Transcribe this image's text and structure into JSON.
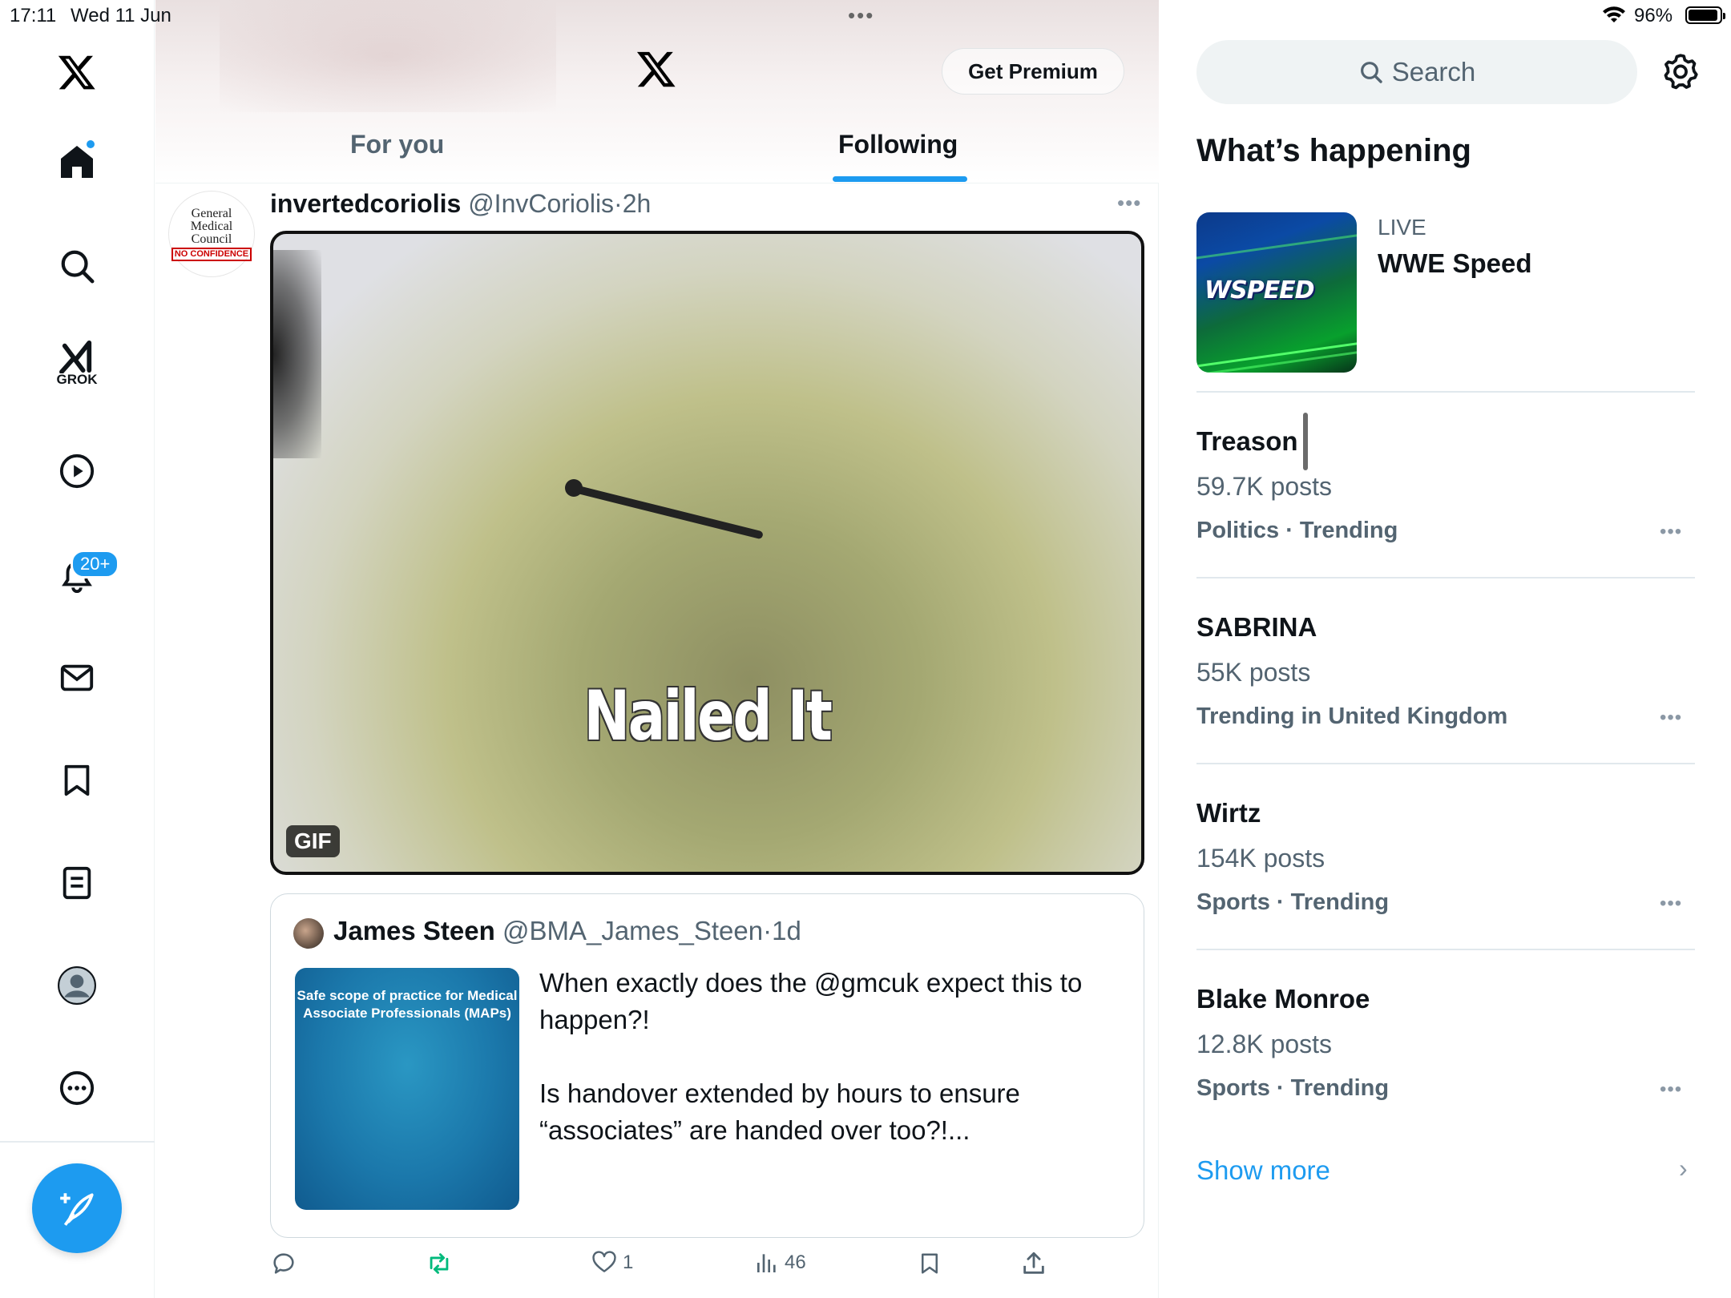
{
  "status": {
    "time": "17:11",
    "date": "Wed 11 Jun",
    "battery": "96%"
  },
  "nav": {
    "grok_label": "GROK",
    "notifications_badge": "20+"
  },
  "header": {
    "premium_label": "Get Premium",
    "tabs": [
      {
        "label": "For you",
        "active": false
      },
      {
        "label": "Following",
        "active": true
      }
    ]
  },
  "post": {
    "avatar_text": [
      "General",
      "Medical",
      "Council"
    ],
    "avatar_stamp": "NO CONFIDENCE",
    "name": "invertedcoriolis",
    "handle": "@InvCoriolis",
    "separator": "·",
    "time": "2h",
    "gif_caption": "Nailed It",
    "gif_label": "GIF",
    "quote": {
      "name": "James Steen",
      "handle": "@BMA_James_Steen",
      "separator": "·",
      "time": "1d",
      "image_text": "Safe scope of practice for Medical Associate Professionals (MAPs)",
      "text_p1": "When exactly does the @gmcuk expect this to happen?!",
      "text_p2": "Is handover extended by hours to ensure “associates” are handed over too?!..."
    },
    "actions": {
      "likes": "1",
      "views": "46"
    }
  },
  "sidebar": {
    "search_placeholder": "Search",
    "title": "What’s happening",
    "live": {
      "label": "LIVE",
      "title": "WWE Speed",
      "image_text": "SPEED"
    },
    "trends": [
      {
        "name": "Treason",
        "posts": "59.7K posts",
        "category": "Politics · Trending"
      },
      {
        "name": "SABRINA",
        "posts": "55K posts",
        "category": "Trending in United Kingdom"
      },
      {
        "name": "Wirtz",
        "posts": "154K posts",
        "category": "Sports · Trending"
      },
      {
        "name": "Blake Monroe",
        "posts": "12.8K posts",
        "category": "Sports · Trending"
      }
    ],
    "show_more": "Show more"
  },
  "colors": {
    "accent": "#1d9bf0",
    "text_primary": "#0f1419",
    "text_secondary": "#536471",
    "repost_green": "#00ba7c"
  },
  "icons": [
    "x-logo-icon",
    "home-icon",
    "search-icon",
    "grok-icon",
    "video-icon",
    "bell-icon",
    "mail-icon",
    "bookmark-icon",
    "lists-icon",
    "profile-icon",
    "more-icon",
    "compose-icon",
    "reply-icon",
    "repost-icon",
    "like-icon",
    "views-icon",
    "share-icon",
    "gear-icon",
    "chevron-right-icon"
  ]
}
